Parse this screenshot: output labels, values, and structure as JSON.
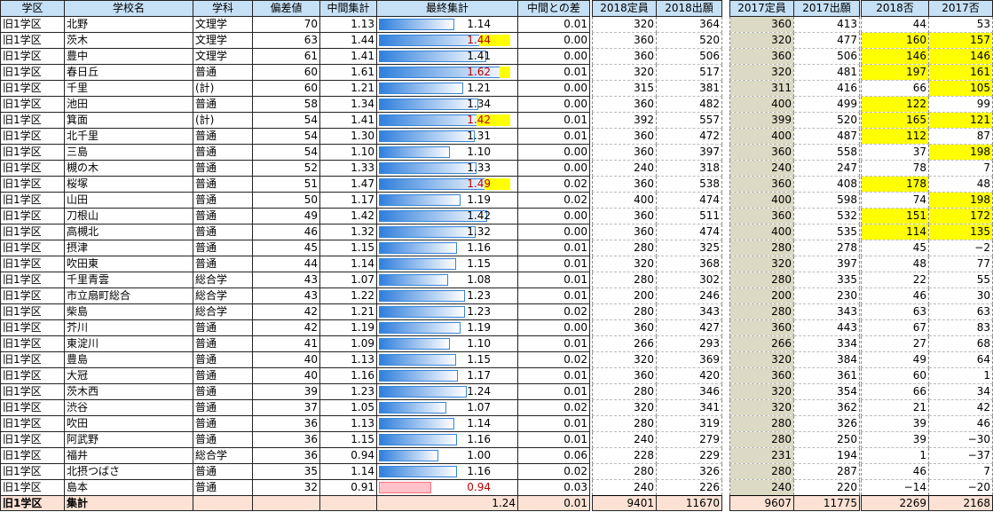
{
  "headers_left": [
    "学区",
    "学校名",
    "学科",
    "偏差値",
    "中間集計",
    "最終集計",
    "中間との差"
  ],
  "headers_2018": [
    "2018定員",
    "2018出願"
  ],
  "headers_2017": [
    "2017定員",
    "2017出願"
  ],
  "headers_right": [
    "2018否",
    "2017否"
  ],
  "rows": [
    {
      "area": "旧1学区",
      "school": "北野",
      "dept": "文理学",
      "dev": "70",
      "mid": "1.13",
      "final": "1.14",
      "diff": "0.01",
      "cap18": "320",
      "app18": "364",
      "cap17": "360",
      "app17": "413",
      "rej18": "44",
      "rej17": "53"
    },
    {
      "area": "旧1学区",
      "school": "茨木",
      "dept": "文理学",
      "dev": "63",
      "mid": "1.44",
      "final": "1.44",
      "diff": "0.00",
      "cap18": "360",
      "app18": "520",
      "cap17": "320",
      "app17": "477",
      "rej18": "160",
      "rej17": "157"
    },
    {
      "area": "旧1学区",
      "school": "豊中",
      "dept": "文理学",
      "dev": "61",
      "mid": "1.41",
      "final": "1.41",
      "diff": "0.00",
      "cap18": "360",
      "app18": "506",
      "cap17": "360",
      "app17": "506",
      "rej18": "146",
      "rej17": "146"
    },
    {
      "area": "旧1学区",
      "school": "春日丘",
      "dept": "普通",
      "dev": "60",
      "mid": "1.61",
      "final": "1.62",
      "diff": "0.01",
      "cap18": "320",
      "app18": "517",
      "cap17": "320",
      "app17": "481",
      "rej18": "197",
      "rej17": "161"
    },
    {
      "area": "旧1学区",
      "school": "千里",
      "dept": "(計)",
      "dev": "60",
      "mid": "1.21",
      "final": "1.21",
      "diff": "0.00",
      "cap18": "315",
      "app18": "381",
      "cap17": "311",
      "app17": "416",
      "rej18": "66",
      "rej17": "105"
    },
    {
      "area": "旧1学区",
      "school": "池田",
      "dept": "普通",
      "dev": "58",
      "mid": "1.34",
      "final": "1.34",
      "diff": "0.00",
      "cap18": "360",
      "app18": "482",
      "cap17": "400",
      "app17": "499",
      "rej18": "122",
      "rej17": "99"
    },
    {
      "area": "旧1学区",
      "school": "箕面",
      "dept": "(計)",
      "dev": "54",
      "mid": "1.41",
      "final": "1.42",
      "diff": "0.01",
      "cap18": "392",
      "app18": "557",
      "cap17": "399",
      "app17": "520",
      "rej18": "165",
      "rej17": "121"
    },
    {
      "area": "旧1学区",
      "school": "北千里",
      "dept": "普通",
      "dev": "54",
      "mid": "1.30",
      "final": "1.31",
      "diff": "0.01",
      "cap18": "360",
      "app18": "472",
      "cap17": "400",
      "app17": "487",
      "rej18": "112",
      "rej17": "87"
    },
    {
      "area": "旧1学区",
      "school": "三島",
      "dept": "普通",
      "dev": "54",
      "mid": "1.10",
      "final": "1.10",
      "diff": "0.00",
      "cap18": "360",
      "app18": "397",
      "cap17": "360",
      "app17": "558",
      "rej18": "37",
      "rej17": "198"
    },
    {
      "area": "旧1学区",
      "school": "槻の木",
      "dept": "普通",
      "dev": "52",
      "mid": "1.33",
      "final": "1.33",
      "diff": "0.00",
      "cap18": "240",
      "app18": "318",
      "cap17": "240",
      "app17": "247",
      "rej18": "78",
      "rej17": "7"
    },
    {
      "area": "旧1学区",
      "school": "桜塚",
      "dept": "普通",
      "dev": "51",
      "mid": "1.47",
      "final": "1.49",
      "diff": "0.02",
      "cap18": "360",
      "app18": "538",
      "cap17": "360",
      "app17": "408",
      "rej18": "178",
      "rej17": "48"
    },
    {
      "area": "旧1学区",
      "school": "山田",
      "dept": "普通",
      "dev": "50",
      "mid": "1.17",
      "final": "1.19",
      "diff": "0.02",
      "cap18": "400",
      "app18": "474",
      "cap17": "400",
      "app17": "598",
      "rej18": "74",
      "rej17": "198"
    },
    {
      "area": "旧1学区",
      "school": "刀根山",
      "dept": "普通",
      "dev": "49",
      "mid": "1.42",
      "final": "1.42",
      "diff": "0.00",
      "cap18": "360",
      "app18": "511",
      "cap17": "360",
      "app17": "532",
      "rej18": "151",
      "rej17": "172"
    },
    {
      "area": "旧1学区",
      "school": "高槻北",
      "dept": "普通",
      "dev": "46",
      "mid": "1.32",
      "final": "1.32",
      "diff": "0.00",
      "cap18": "360",
      "app18": "474",
      "cap17": "400",
      "app17": "535",
      "rej18": "114",
      "rej17": "135"
    },
    {
      "area": "旧1学区",
      "school": "摂津",
      "dept": "普通",
      "dev": "45",
      "mid": "1.15",
      "final": "1.16",
      "diff": "0.01",
      "cap18": "280",
      "app18": "325",
      "cap17": "280",
      "app17": "278",
      "rej18": "45",
      "rej17": "−2"
    },
    {
      "area": "旧1学区",
      "school": "吹田東",
      "dept": "普通",
      "dev": "44",
      "mid": "1.14",
      "final": "1.15",
      "diff": "0.01",
      "cap18": "320",
      "app18": "368",
      "cap17": "320",
      "app17": "397",
      "rej18": "48",
      "rej17": "77"
    },
    {
      "area": "旧1学区",
      "school": "千里青雲",
      "dept": "総合学",
      "dev": "43",
      "mid": "1.07",
      "final": "1.08",
      "diff": "0.01",
      "cap18": "280",
      "app18": "302",
      "cap17": "280",
      "app17": "335",
      "rej18": "22",
      "rej17": "55"
    },
    {
      "area": "旧1学区",
      "school": "市立扇町総合",
      "dept": "総合学",
      "dev": "43",
      "mid": "1.22",
      "final": "1.23",
      "diff": "0.01",
      "cap18": "200",
      "app18": "246",
      "cap17": "200",
      "app17": "230",
      "rej18": "46",
      "rej17": "30"
    },
    {
      "area": "旧1学区",
      "school": "柴島",
      "dept": "総合学",
      "dev": "42",
      "mid": "1.21",
      "final": "1.23",
      "diff": "0.02",
      "cap18": "280",
      "app18": "343",
      "cap17": "280",
      "app17": "343",
      "rej18": "63",
      "rej17": "63"
    },
    {
      "area": "旧1学区",
      "school": "芥川",
      "dept": "普通",
      "dev": "42",
      "mid": "1.19",
      "final": "1.19",
      "diff": "0.00",
      "cap18": "360",
      "app18": "427",
      "cap17": "360",
      "app17": "443",
      "rej18": "67",
      "rej17": "83"
    },
    {
      "area": "旧1学区",
      "school": "東淀川",
      "dept": "普通",
      "dev": "41",
      "mid": "1.09",
      "final": "1.10",
      "diff": "0.01",
      "cap18": "266",
      "app18": "293",
      "cap17": "266",
      "app17": "334",
      "rej18": "27",
      "rej17": "68"
    },
    {
      "area": "旧1学区",
      "school": "豊島",
      "dept": "普通",
      "dev": "40",
      "mid": "1.13",
      "final": "1.15",
      "diff": "0.02",
      "cap18": "320",
      "app18": "369",
      "cap17": "320",
      "app17": "384",
      "rej18": "49",
      "rej17": "64"
    },
    {
      "area": "旧1学区",
      "school": "大冠",
      "dept": "普通",
      "dev": "40",
      "mid": "1.16",
      "final": "1.17",
      "diff": "0.01",
      "cap18": "360",
      "app18": "420",
      "cap17": "360",
      "app17": "361",
      "rej18": "60",
      "rej17": "1"
    },
    {
      "area": "旧1学区",
      "school": "茨木西",
      "dept": "普通",
      "dev": "39",
      "mid": "1.23",
      "final": "1.24",
      "diff": "0.01",
      "cap18": "280",
      "app18": "346",
      "cap17": "320",
      "app17": "354",
      "rej18": "66",
      "rej17": "34"
    },
    {
      "area": "旧1学区",
      "school": "渋谷",
      "dept": "普通",
      "dev": "37",
      "mid": "1.05",
      "final": "1.07",
      "diff": "0.02",
      "cap18": "320",
      "app18": "341",
      "cap17": "320",
      "app17": "362",
      "rej18": "21",
      "rej17": "42"
    },
    {
      "area": "旧1学区",
      "school": "吹田",
      "dept": "普通",
      "dev": "36",
      "mid": "1.13",
      "final": "1.14",
      "diff": "0.01",
      "cap18": "280",
      "app18": "319",
      "cap17": "280",
      "app17": "326",
      "rej18": "39",
      "rej17": "46"
    },
    {
      "area": "旧1学区",
      "school": "阿武野",
      "dept": "普通",
      "dev": "36",
      "mid": "1.15",
      "final": "1.16",
      "diff": "0.01",
      "cap18": "240",
      "app18": "279",
      "cap17": "280",
      "app17": "250",
      "rej18": "39",
      "rej17": "−30"
    },
    {
      "area": "旧1学区",
      "school": "福井",
      "dept": "総合学",
      "dev": "36",
      "mid": "0.94",
      "final": "1.00",
      "diff": "0.06",
      "cap18": "228",
      "app18": "229",
      "cap17": "231",
      "app17": "194",
      "rej18": "1",
      "rej17": "−37"
    },
    {
      "area": "旧1学区",
      "school": "北摂つばさ",
      "dept": "普通",
      "dev": "35",
      "mid": "1.14",
      "final": "1.16",
      "diff": "0.02",
      "cap18": "280",
      "app18": "326",
      "cap17": "280",
      "app17": "287",
      "rej18": "46",
      "rej17": "7"
    },
    {
      "area": "旧1学区",
      "school": "島本",
      "dept": "普通",
      "dev": "32",
      "mid": "0.91",
      "final": "0.94",
      "diff": "0.03",
      "cap18": "240",
      "app18": "226",
      "cap17": "240",
      "app17": "220",
      "rej18": "−14",
      "rej17": "−20"
    }
  ],
  "total": {
    "area": "旧1学区",
    "label": "集計",
    "final": "1.24",
    "diff": "0.01",
    "cap18": "9401",
    "app18": "11670",
    "cap17": "9607",
    "app17": "11775",
    "rej18": "2269",
    "rej17": "2168"
  },
  "highlight": {
    "final_rows": [
      1,
      3,
      6,
      10
    ],
    "rej18_rows": [
      1,
      2,
      3,
      5,
      6,
      7,
      10,
      12,
      13
    ],
    "rej17_rows": [
      1,
      2,
      3,
      4,
      6,
      8,
      11,
      12,
      13
    ]
  },
  "colors": {
    "header_bg": "#c6e0f5",
    "gray_col": "#dcd9c4",
    "yellow": "#ffff00",
    "total_bg": "#fbe2d5",
    "bar_blue": "#2f7fdc",
    "bar_red": "#ffc2c8"
  },
  "bar_scale": {
    "min": 0.5,
    "max": 1.65
  }
}
